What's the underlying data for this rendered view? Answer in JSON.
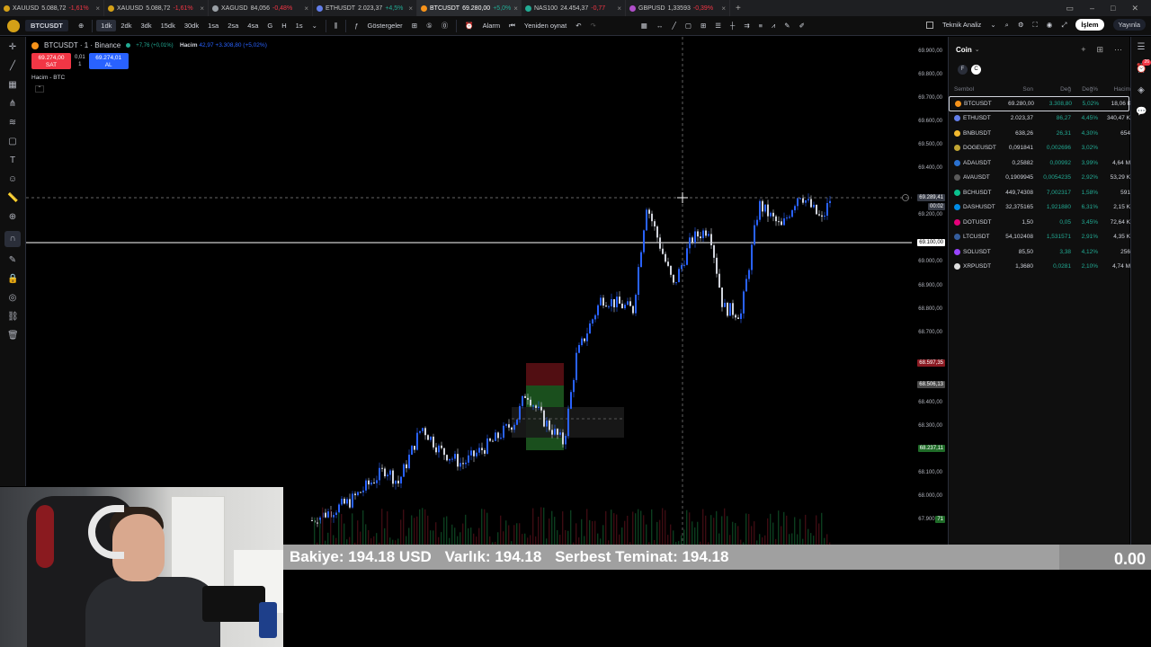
{
  "tabs": [
    {
      "label": "XAUUSD",
      "price": "5.088,72",
      "change": "-1,61%",
      "up": false,
      "color": "#d4a017",
      "active": false
    },
    {
      "label": "XAUUSD",
      "price": "5.088,72",
      "change": "-1,61%",
      "up": false,
      "color": "#d4a017",
      "active": false
    },
    {
      "label": "XAGUSD",
      "price": "84,056",
      "change": "-0,48%",
      "up": false,
      "color": "#9aa0a6",
      "active": false
    },
    {
      "label": "ETHUSDT",
      "price": "2.023,37",
      "change": "+4,5%",
      "up": true,
      "color": "#627eea",
      "active": false
    },
    {
      "label": "BTCUSDT",
      "price": "69.280,00",
      "change": "+5,0%",
      "up": true,
      "color": "#f7931a",
      "active": true
    },
    {
      "label": "NAS100",
      "price": "24.454,37",
      "change": "-0,77",
      "up": false,
      "color": "#22ab94",
      "active": false
    },
    {
      "label": "GBPUSD",
      "price": "1,33593",
      "change": "-0,39%",
      "up": false,
      "color": "#b04ec9",
      "active": false
    }
  ],
  "toolbar": {
    "symbol": "BTCUSDT",
    "intervals": [
      "1dk",
      "2dk",
      "3dk",
      "15dk",
      "30dk",
      "1sa",
      "2sa",
      "4sa",
      "G",
      "H",
      "1s"
    ],
    "active_interval": "1dk",
    "indicators": "Göstergeler",
    "alarm": "Alarm",
    "replay": "Yeniden oynat",
    "tech_analysis": "Teknik Analiz",
    "trade": "İşlem",
    "publish": "Yayınla"
  },
  "chart": {
    "title": "BTCUSDT · 1 · Binance",
    "title_change": "+7,76 (+0,01%)",
    "volume_label": "Hacim",
    "volume_values": "42,97  +3.308,80 (+5,02%)",
    "sell_price": "69.274,00",
    "sell_label": "SAT",
    "buy_price": "69.274,01",
    "buy_label": "AL",
    "spread": "0,01",
    "qty": "1",
    "volume_pane": "Hacim - BTC",
    "price_ticks": [
      "69.900,00",
      "69.800,00",
      "69.700,00",
      "69.600,00",
      "69.500,00",
      "69.400,00",
      "69.200,00",
      "69.000,00",
      "68.900,00",
      "68.800,00",
      "68.700,00",
      "68.400,00",
      "68.300,00",
      "68.200,00",
      "68.100,00",
      "68.000,00",
      "67.900,00"
    ],
    "tag_crosshair": "69.289,41",
    "tag_crosshair_time": "00:02",
    "tag_line": "69.100,00",
    "tag_red": "68.597,35",
    "tag_gray": "68.506,13",
    "tag_green": "68.237,11",
    "tag_volume": "71"
  },
  "watchlist": {
    "title": "Coin",
    "filters": [
      "F",
      "C"
    ],
    "columns": [
      "Sembol",
      "Son",
      "Değ",
      "Değ%",
      "Hacim"
    ],
    "rows": [
      {
        "symbol": "BTCUSDT",
        "last": "69.280,00",
        "chg": "3.308,80",
        "chgp": "5,02%",
        "vol": "18,06 K",
        "color": "#f7931a",
        "selected": true
      },
      {
        "symbol": "ETHUSDT",
        "last": "2.023,37",
        "chg": "86,27",
        "chgp": "4,45%",
        "vol": "340,47 K",
        "color": "#627eea",
        "selected": false
      },
      {
        "symbol": "BNBUSDT",
        "last": "638,26",
        "chg": "26,31",
        "chgp": "4,30%",
        "vol": "654",
        "color": "#f3ba2f",
        "selected": false
      },
      {
        "symbol": "DOGEUSDT",
        "last": "0,091841",
        "chg": "0,002696",
        "chgp": "3,02%",
        "vol": "",
        "color": "#c2a633",
        "selected": false
      },
      {
        "symbol": "ADAUSDT",
        "last": "0,25882",
        "chg": "0,00992",
        "chgp": "3,99%",
        "vol": "4,64 M",
        "color": "#2a71d0",
        "selected": false
      },
      {
        "symbol": "AVAUSDT",
        "last": "0,1909945",
        "chg": "0,0054235",
        "chgp": "2,92%",
        "vol": "53,29 K",
        "color": "#5a5a5a",
        "selected": false
      },
      {
        "symbol": "BCHUSDT",
        "last": "449,74308",
        "chg": "7,002317",
        "chgp": "1,58%",
        "vol": "591",
        "color": "#0ac18e",
        "selected": false
      },
      {
        "symbol": "DASHUSDT",
        "last": "32,375165",
        "chg": "1,921880",
        "chgp": "6,31%",
        "vol": "2,15 K",
        "color": "#008ce7",
        "selected": false
      },
      {
        "symbol": "DOTUSDT",
        "last": "1,50",
        "chg": "0,05",
        "chgp": "3,45%",
        "vol": "72,64 K",
        "color": "#e6007a",
        "selected": false
      },
      {
        "symbol": "LTCUSDT",
        "last": "54,102408",
        "chg": "1,531571",
        "chgp": "2,91%",
        "vol": "4,35 K",
        "color": "#345d9d",
        "selected": false
      },
      {
        "symbol": "SOLUSDT",
        "last": "85,50",
        "chg": "3,38",
        "chgp": "4,12%",
        "vol": "256",
        "color": "#9945ff",
        "selected": false
      },
      {
        "symbol": "XRPUSDT",
        "last": "1,3680",
        "chg": "0,0281",
        "chgp": "2,10%",
        "vol": "4,74 M",
        "color": "#e0e0e0",
        "selected": false
      }
    ]
  },
  "balance": {
    "bakiye": "Bakiye: 194.18 USD",
    "varlik": "Varlık: 194.18",
    "teminat": "Serbest Teminat: 194.18",
    "value": "0.00"
  },
  "rightbar_badge": "26"
}
